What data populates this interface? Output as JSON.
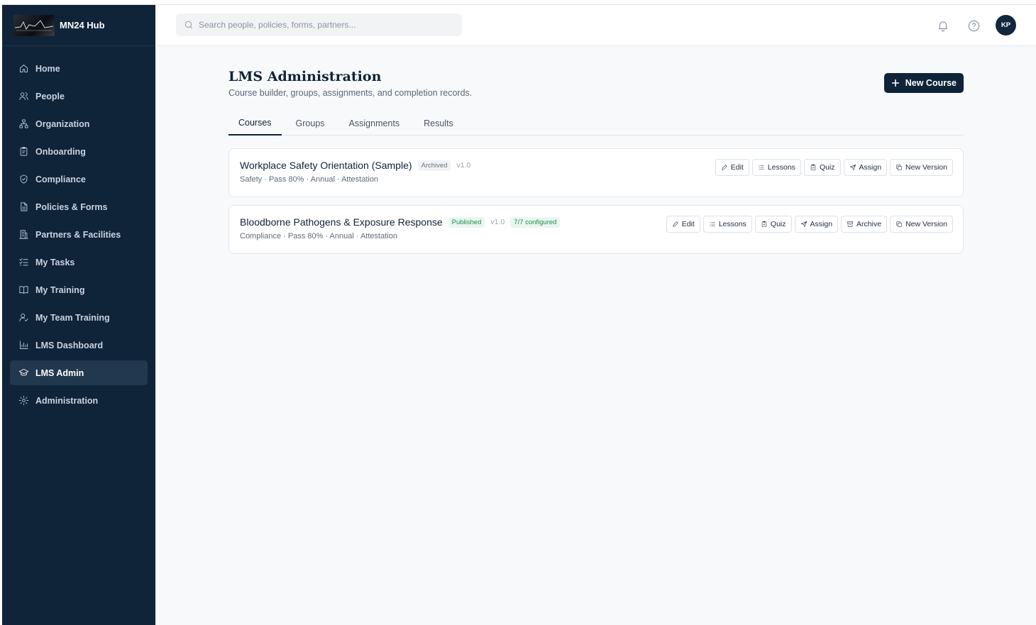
{
  "brand": {
    "name": "MN24 Hub"
  },
  "sidebar": {
    "items": [
      {
        "label": "Home",
        "icon": "home-icon"
      },
      {
        "label": "People",
        "icon": "people-icon"
      },
      {
        "label": "Organization",
        "icon": "org-chart-icon"
      },
      {
        "label": "Onboarding",
        "icon": "clipboard-icon"
      },
      {
        "label": "Compliance",
        "icon": "shield-icon"
      },
      {
        "label": "Policies & Forms",
        "icon": "document-icon"
      },
      {
        "label": "Partners & Facilities",
        "icon": "building-icon"
      },
      {
        "label": "My Tasks",
        "icon": "checklist-icon"
      },
      {
        "label": "My Training",
        "icon": "book-icon"
      },
      {
        "label": "My Team Training",
        "icon": "user-check-icon"
      },
      {
        "label": "LMS Dashboard",
        "icon": "bar-chart-icon"
      },
      {
        "label": "LMS Admin",
        "icon": "graduation-cap-icon",
        "active": true
      },
      {
        "label": "Administration",
        "icon": "gear-icon"
      }
    ]
  },
  "topbar": {
    "search_placeholder": "Search people, policies, forms, partners...",
    "avatar_initials": "KP"
  },
  "page": {
    "title": "LMS Administration",
    "subtitle": "Course builder, groups, assignments, and completion records.",
    "new_course_label": "New Course"
  },
  "tabs": [
    "Courses",
    "Groups",
    "Assignments",
    "Results"
  ],
  "active_tab": "Courses",
  "courses": [
    {
      "title": "Workplace Safety Orientation (Sample)",
      "status": "Archived",
      "version": "v1.0",
      "config": "",
      "meta": "Safety · Pass 80% · Annual · Attestation",
      "actions": [
        "Edit",
        "Lessons",
        "Quiz",
        "Assign",
        "New Version"
      ]
    },
    {
      "title": "Bloodborne Pathogens & Exposure Response",
      "status": "Published",
      "version": "v1.0",
      "config": "7/7 configured",
      "meta": "Compliance · Pass 80% · Annual · Attestation",
      "actions": [
        "Edit",
        "Lessons",
        "Quiz",
        "Assign",
        "Archive",
        "New Version"
      ]
    }
  ],
  "colors": {
    "sidebar_bg": "#0f2339",
    "sidebar_active": "#22384f",
    "primary": "#0f2339",
    "published_green": "#1f8a4c"
  }
}
